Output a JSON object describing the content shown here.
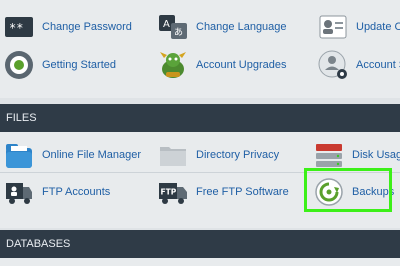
{
  "preferences": {
    "row1": [
      {
        "label": "Change Password",
        "icon": "password-icon"
      },
      {
        "label": "Change Language",
        "icon": "language-icon"
      },
      {
        "label": "Update Con",
        "icon": "contact-card-icon"
      }
    ],
    "row2": [
      {
        "label": "Getting Started",
        "icon": "getting-started-icon"
      },
      {
        "label": "Account Upgrades",
        "icon": "dragon-icon"
      },
      {
        "label": "Account Set",
        "icon": "account-settings-icon"
      }
    ],
    "lang_glyphs": {
      "a": "A",
      "b": "あ"
    },
    "password_glyph": "**"
  },
  "files": {
    "header": "FILES",
    "row1": [
      {
        "label": "Online File Manager",
        "icon": "file-manager-icon"
      },
      {
        "label": "Directory Privacy",
        "icon": "folder-icon"
      },
      {
        "label": "Disk Usage",
        "icon": "disk-usage-icon"
      }
    ],
    "row2": [
      {
        "label": "FTP Accounts",
        "icon": "ftp-accounts-icon"
      },
      {
        "label": "Free FTP Software",
        "icon": "ftp-truck-icon"
      },
      {
        "label": "Backups",
        "icon": "backups-icon"
      }
    ],
    "ftp_glyph": "FTP"
  },
  "databases": {
    "header": "DATABASES"
  },
  "colors": {
    "link": "#1f5fa5",
    "header_bg": "#2f3b47",
    "highlight": "#3cf018"
  }
}
